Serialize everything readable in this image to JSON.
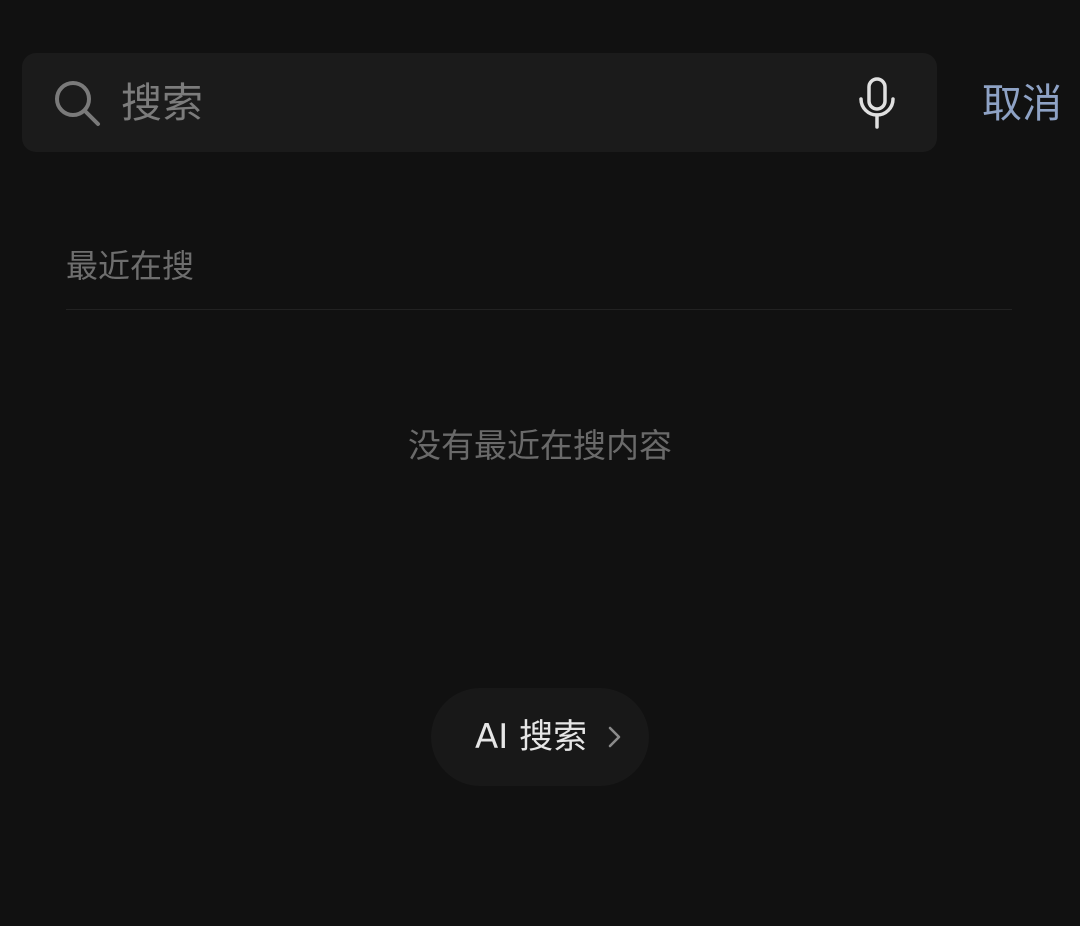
{
  "search": {
    "placeholder": "搜索",
    "cancel_label": "取消"
  },
  "recent": {
    "title": "最近在搜",
    "empty_message": "没有最近在搜内容"
  },
  "ai_search": {
    "label": "AI 搜索"
  },
  "icons": {
    "search": "search-icon",
    "mic": "mic-icon",
    "chevron": "chevron-right-icon"
  },
  "colors": {
    "background": "#111111",
    "search_bar": "#1b1b1b",
    "accent": "#8ea2c5",
    "muted_text": "#6e6e6e",
    "primary_text": "#e6e6e6"
  }
}
